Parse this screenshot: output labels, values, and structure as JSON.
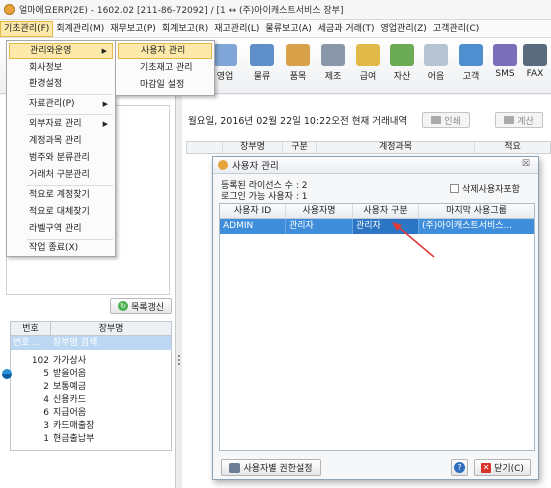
{
  "window": {
    "title": "얼마에요ERP(2E) - 1602.02 [211-86-72092] / [1 ↔ (주)아이캐스트서비스 장부]"
  },
  "menubar": [
    "기초관리(F)",
    "회계관리(M)",
    "재무보고(P)",
    "회계보고(R)",
    "재고관리(L)",
    "물류보고(A)",
    "세금과 거래(T)",
    "영업관리(Z)",
    "고객관리(C)"
  ],
  "toolbar": [
    {
      "label": "영업",
      "icon": "sales-icon"
    },
    {
      "label": "물류",
      "icon": "logistics-icon"
    },
    {
      "label": "품목",
      "icon": "items-icon"
    },
    {
      "label": "제조",
      "icon": "manufacturing-icon"
    },
    {
      "label": "급여",
      "icon": "payroll-icon"
    },
    {
      "label": "자산",
      "icon": "assets-icon"
    },
    {
      "label": "어음",
      "icon": "bills-icon"
    },
    {
      "label": "고객",
      "icon": "customer-icon"
    },
    {
      "label": "SMS",
      "icon": "sms-icon"
    },
    {
      "label": "FAX",
      "icon": "fax-icon"
    }
  ],
  "context_menu": {
    "items": [
      {
        "label": "관리와운영",
        "submenu": true,
        "highlighted": true
      },
      {
        "label": "회사정보"
      },
      {
        "label": "환경설정"
      },
      {
        "label": "자료관리(P)",
        "submenu": true
      },
      {
        "label": "외부자료 관리",
        "submenu": true
      },
      {
        "label": "계정과목 관리"
      },
      {
        "label": "범주와 분류관리"
      },
      {
        "label": "거래처 구분관리"
      },
      {
        "label": "적요로 계정찾기"
      },
      {
        "label": "적요로 대체찾기"
      },
      {
        "label": "라벨구역 관리"
      },
      {
        "label": "작업 종료(X)"
      }
    ],
    "submenu": [
      {
        "label": "사용자 관리",
        "highlighted": true
      },
      {
        "label": "기초재고 관리"
      },
      {
        "label": "마감일 설정"
      }
    ]
  },
  "left_panel": {
    "refresh_button": "목록갱신",
    "table": {
      "headers": [
        "번호",
        "장부명"
      ],
      "search": {
        "no": "번호 ...",
        "name": "장부명 검색"
      },
      "rows": [
        {
          "no": "102",
          "name": "가가상사"
        },
        {
          "no": "5",
          "name": "받을어음"
        },
        {
          "no": "2",
          "name": "보통예금"
        },
        {
          "no": "4",
          "name": "신용카드"
        },
        {
          "no": "6",
          "name": "지급어음"
        },
        {
          "no": "3",
          "name": "카드매출장"
        },
        {
          "no": "1",
          "name": "현금출납부"
        }
      ]
    }
  },
  "right_panel": {
    "subtitle": "월요일, 2016년 02월 22일 10:22오전 현재 거래내역",
    "print_button": "인쇄",
    "calc_button": "계산",
    "grid_headers": [
      "",
      "장부명",
      "구분",
      "계정과목",
      "적요"
    ]
  },
  "dialog": {
    "title": "사용자 관리",
    "close_glyph": "☒",
    "license_count": "등록된 라이선스 수 : 2",
    "login_users": "로그인 가능 사용자 : 1",
    "include_deleted_label": "삭제사용자포함",
    "table": {
      "headers": [
        "사용자 ID",
        "사용자명",
        "사용자 구분",
        "마지막 사용그룹"
      ],
      "rows": [
        {
          "id": "ADMIN",
          "name": "관리자",
          "type": "관리자",
          "group": "(주)아이캐스트서비스..."
        }
      ]
    },
    "perm_button": "사용자별 권한설정",
    "help_glyph": "?",
    "close_button": "닫기(C)"
  },
  "colors": {
    "menu_highlight": "#fde9a9",
    "selected_row": "#3f8edc",
    "annotation_arrow": "#e03a3a"
  }
}
